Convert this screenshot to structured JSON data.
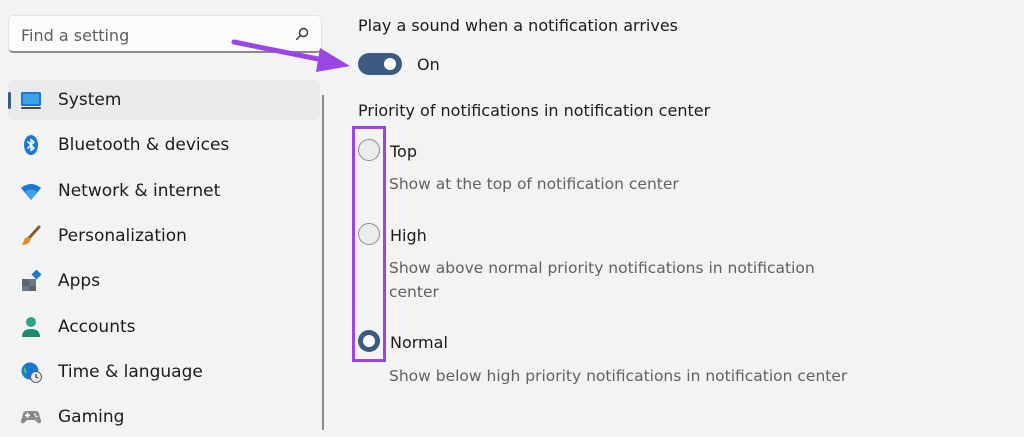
{
  "sidebar": {
    "search": {
      "placeholder": "Find a setting",
      "icon": "search-icon"
    },
    "items": [
      {
        "label": "System",
        "icon": "system-icon",
        "active": true
      },
      {
        "label": "Bluetooth & devices",
        "icon": "bluetooth-icon"
      },
      {
        "label": "Network & internet",
        "icon": "wifi-icon"
      },
      {
        "label": "Personalization",
        "icon": "brush-icon"
      },
      {
        "label": "Apps",
        "icon": "apps-icon"
      },
      {
        "label": "Accounts",
        "icon": "person-icon"
      },
      {
        "label": "Time & language",
        "icon": "globe-clock-icon"
      },
      {
        "label": "Gaming",
        "icon": "gamepad-icon"
      }
    ]
  },
  "main": {
    "sound_heading": "Play a sound when a notification arrives",
    "sound_toggle": {
      "state": "On",
      "enabled": true
    },
    "priority_heading": "Priority of notifications in notification center",
    "priority_options": [
      {
        "label": "Top",
        "description": "Show at the top of notification center",
        "checked": false
      },
      {
        "label": "High",
        "description_line1": "Show above normal priority notifications in notification",
        "description_line2": "center",
        "checked": false
      },
      {
        "label": "Normal",
        "description": "Show below high priority notifications in notification center",
        "checked": true
      }
    ]
  },
  "colors": {
    "accent": "#3d5a80",
    "annotation": "#9b45e6",
    "background": "#f3f3f3"
  }
}
